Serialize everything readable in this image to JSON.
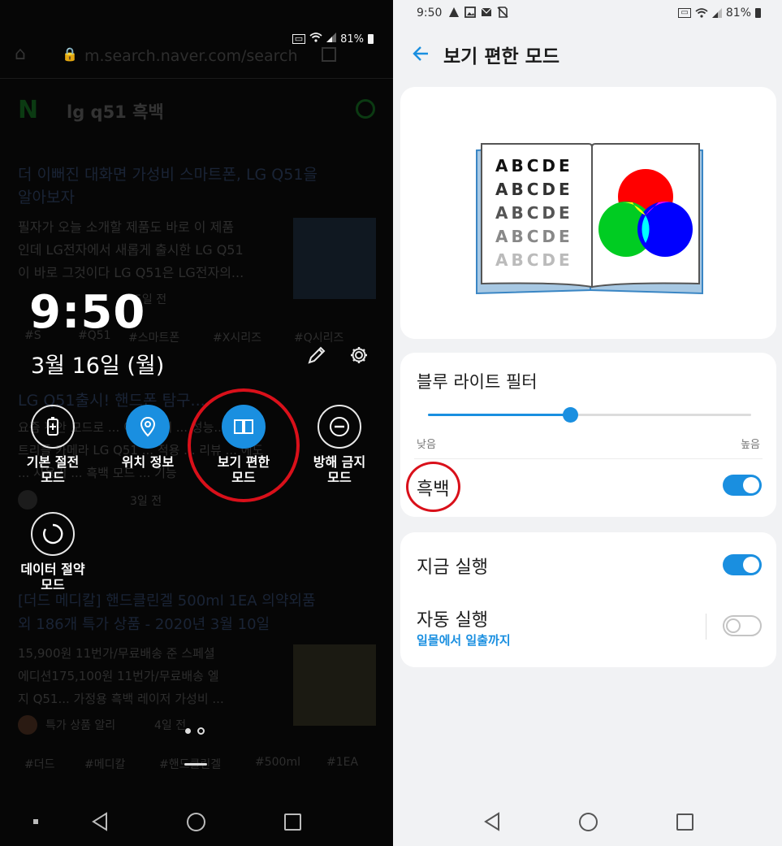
{
  "left_screen": {
    "background_page": {
      "url": "m.search.naver.com/search",
      "search_query": "lg q51 흑백",
      "logo_letter": "N",
      "result1_title_line1": "더 이뻐진 대화면 가성비 스마트폰, LG Q51을",
      "result1_title_line2": "알아보자",
      "result1_snippet_line1": "필자가 오늘 소개할 제품도 바로 이 제품",
      "result1_snippet_line2": "인데 LG전자에서 새롭게 출시한 LG Q51",
      "result1_snippet_line3": "이 바로 그것이다 LG Q51은 LG전자의...",
      "result1_meta": "5일 전",
      "result1_tags": [
        "#S",
        "#Q51",
        "#스마트폰",
        "#X시리즈",
        "#Q시리즈"
      ],
      "result2_title": "LG Q51출시! 핸드폰 탐구...",
      "result2_snippet_line1": "요즘 편안 모드로 ... 이 가격에 ... 성능...",
      "result2_snippet_line2": "트리플 카메라 LG Q51 ... 적용 ... 리뷰 ... 에도",
      "result2_snippet_line3": "... 사용기 ... 흑백 모드 ... 기능",
      "result2_meta": "3일 전",
      "result3_title_line1": "[더드 메디칼] 핸드클린겔 500ml 1EA 의약외품",
      "result3_title_line2": "외 186개 특가 상품 - 2020년 3월 10일",
      "result3_snippet_line1": "15,900원 11번가/무료배송 준 스페셜",
      "result3_snippet_line2": "에디션175,100원 11번가/무료배송 엘",
      "result3_snippet_line3": "지 Q51... 가정용 흑백 레이저 가성비 ...",
      "result3_meta": "특가 상품 알리",
      "result3_meta2": "4일 전",
      "result3_tags": [
        "#더드",
        "#메디칼",
        "#핸드클린겔",
        "#500ml",
        "#1EA"
      ]
    },
    "status": {
      "battery": "81%"
    },
    "clock": "9:50",
    "date": "3월 16일 (월)",
    "tiles": [
      {
        "label_line1": "기본 절전",
        "label_line2": "모드",
        "icon": "battery-saver-icon",
        "active": false
      },
      {
        "label_line1": "위치 정보",
        "label_line2": "",
        "icon": "location-icon",
        "active": true
      },
      {
        "label_line1": "보기 편한",
        "label_line2": "모드",
        "icon": "book-icon",
        "active": true
      },
      {
        "label_line1": "방해 금지",
        "label_line2": "모드",
        "icon": "minus-circle-icon",
        "active": false
      },
      {
        "label_line1": "데이터 절약",
        "label_line2": "모드",
        "icon": "data-saver-icon",
        "active": false
      }
    ],
    "highlight_color": "#d9101a"
  },
  "right_screen": {
    "status": {
      "time": "9:50",
      "battery": "81%"
    },
    "header": {
      "title": "보기 편한 모드"
    },
    "illustration": {
      "letters": [
        "ABCDE",
        "ABCDE",
        "ABCDE",
        "ABCDE",
        "ABCDE"
      ]
    },
    "blue_light": {
      "title": "블루 라이트 필터",
      "level": 0.44,
      "low_label": "낮음",
      "high_label": "높음"
    },
    "grayscale": {
      "label": "흑백",
      "on": true
    },
    "run_now": {
      "label": "지금 실행",
      "on": true
    },
    "auto_run": {
      "label": "자동 실행",
      "sublabel": "일몰에서 일출까지",
      "on": false
    },
    "accent_color": "#1a8fe0"
  }
}
